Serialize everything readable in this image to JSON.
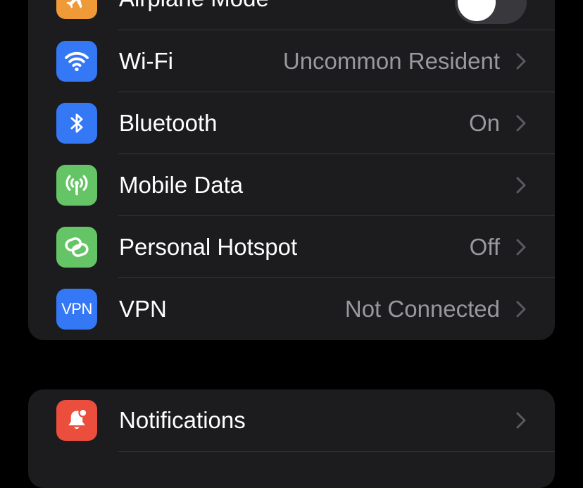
{
  "colors": {
    "background": "#000000",
    "group": "#1c1c1e",
    "separator": "#38383a",
    "label": "#ffffff",
    "secondary": "#98989e",
    "airplane": "#f09a37",
    "blue": "#3478f6",
    "green": "#65c466",
    "red": "#eb4e3d"
  },
  "connectivity": {
    "airplane": {
      "label": "Airplane Mode",
      "icon": "airplane-icon",
      "toggle_on": false
    },
    "wifi": {
      "label": "Wi-Fi",
      "value": "Uncommon Resident",
      "icon": "wifi-icon"
    },
    "bluetooth": {
      "label": "Bluetooth",
      "value": "On",
      "icon": "bluetooth-icon"
    },
    "mobile_data": {
      "label": "Mobile Data",
      "value": "",
      "icon": "antenna-icon"
    },
    "hotspot": {
      "label": "Personal Hotspot",
      "value": "Off",
      "icon": "hotspot-link-icon"
    },
    "vpn": {
      "label": "VPN",
      "value": "Not Connected",
      "icon": "vpn-icon",
      "icon_text": "VPN"
    }
  },
  "general": {
    "notifications": {
      "label": "Notifications",
      "icon": "bell-icon"
    }
  }
}
